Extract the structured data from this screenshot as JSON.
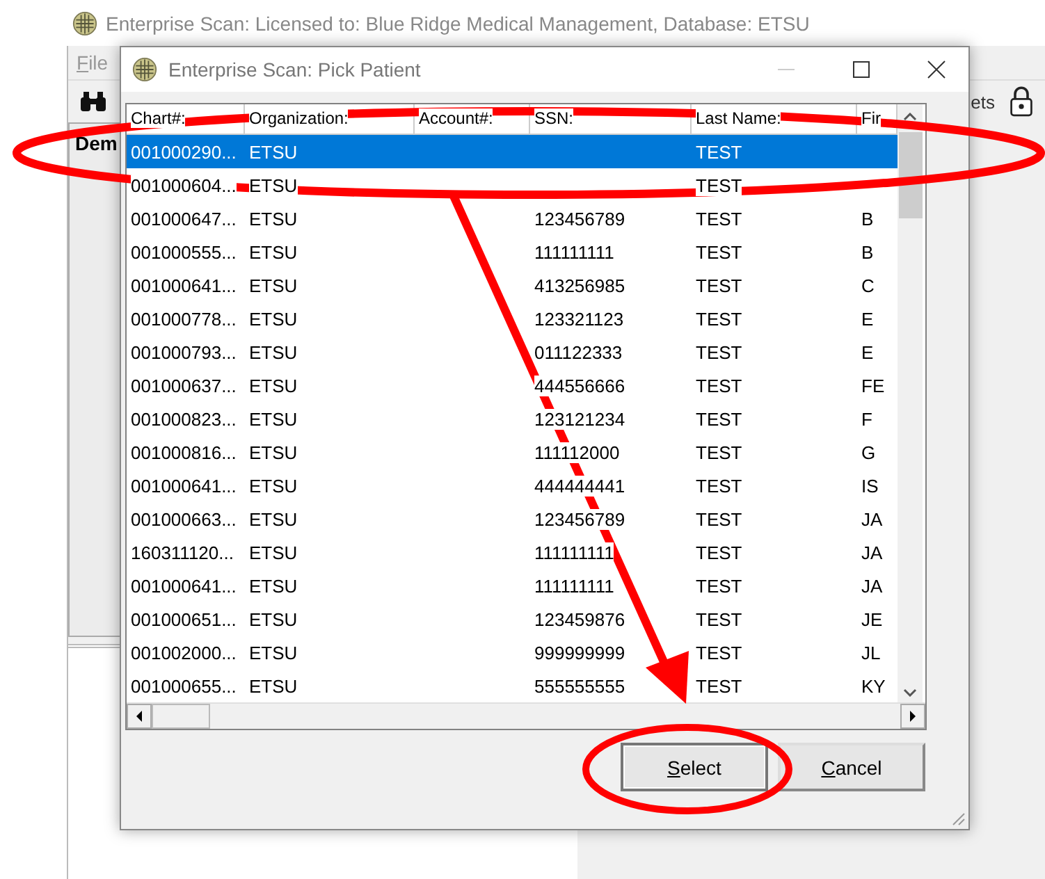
{
  "app": {
    "title": "Enterprise Scan: Licensed to: Blue Ridge Medical Management, Database: ETSU",
    "menu": [
      {
        "label": "File"
      }
    ],
    "toolbar_text": "ets",
    "section_label": "Dem"
  },
  "dialog": {
    "title": "Enterprise Scan: Pick Patient",
    "columns": [
      "Chart#:",
      "Organization:",
      "Account#:",
      "SSN:",
      "Last Name:",
      "Fir"
    ],
    "rows": [
      {
        "cells": [
          "001000290...",
          "ETSU",
          "",
          "",
          "TEST",
          ""
        ],
        "selected": true
      },
      {
        "cells": [
          "001000604...",
          "ETSU",
          "",
          "",
          "TEST",
          ""
        ],
        "selected": false
      },
      {
        "cells": [
          "001000647...",
          "ETSU",
          "",
          "123456789",
          "TEST",
          "B"
        ],
        "selected": false
      },
      {
        "cells": [
          "001000555...",
          "ETSU",
          "",
          "111111111",
          "TEST",
          "B"
        ],
        "selected": false
      },
      {
        "cells": [
          "001000641...",
          "ETSU",
          "",
          "413256985",
          "TEST",
          "C"
        ],
        "selected": false
      },
      {
        "cells": [
          "001000778...",
          "ETSU",
          "",
          "123321123",
          "TEST",
          "E"
        ],
        "selected": false
      },
      {
        "cells": [
          "001000793...",
          "ETSU",
          "",
          "011122333",
          "TEST",
          "E"
        ],
        "selected": false
      },
      {
        "cells": [
          "001000637...",
          "ETSU",
          "",
          "444556666",
          "TEST",
          "FE"
        ],
        "selected": false
      },
      {
        "cells": [
          "001000823...",
          "ETSU",
          "",
          "123121234",
          "TEST",
          "F"
        ],
        "selected": false
      },
      {
        "cells": [
          "001000816...",
          "ETSU",
          "",
          "111112000",
          "TEST",
          "G"
        ],
        "selected": false
      },
      {
        "cells": [
          "001000641...",
          "ETSU",
          "",
          "444444441",
          "TEST",
          "IS"
        ],
        "selected": false
      },
      {
        "cells": [
          "001000663...",
          "ETSU",
          "",
          "123456789",
          "TEST",
          "JA"
        ],
        "selected": false
      },
      {
        "cells": [
          "160311120...",
          "ETSU",
          "",
          "111111111",
          "TEST",
          "JA"
        ],
        "selected": false
      },
      {
        "cells": [
          "001000641...",
          "ETSU",
          "",
          "111111111",
          "TEST",
          "JA"
        ],
        "selected": false
      },
      {
        "cells": [
          "001000651...",
          "ETSU",
          "",
          "123459876",
          "TEST",
          "JE"
        ],
        "selected": false
      },
      {
        "cells": [
          "001002000...",
          "ETSU",
          "",
          "999999999",
          "TEST",
          "JL"
        ],
        "selected": false
      },
      {
        "cells": [
          "001000655...",
          "ETSU",
          "",
          "555555555",
          "TEST",
          "KY"
        ],
        "selected": false
      }
    ],
    "buttons": [
      {
        "label": "Select",
        "default": true
      },
      {
        "label": "Cancel",
        "default": false
      }
    ]
  }
}
